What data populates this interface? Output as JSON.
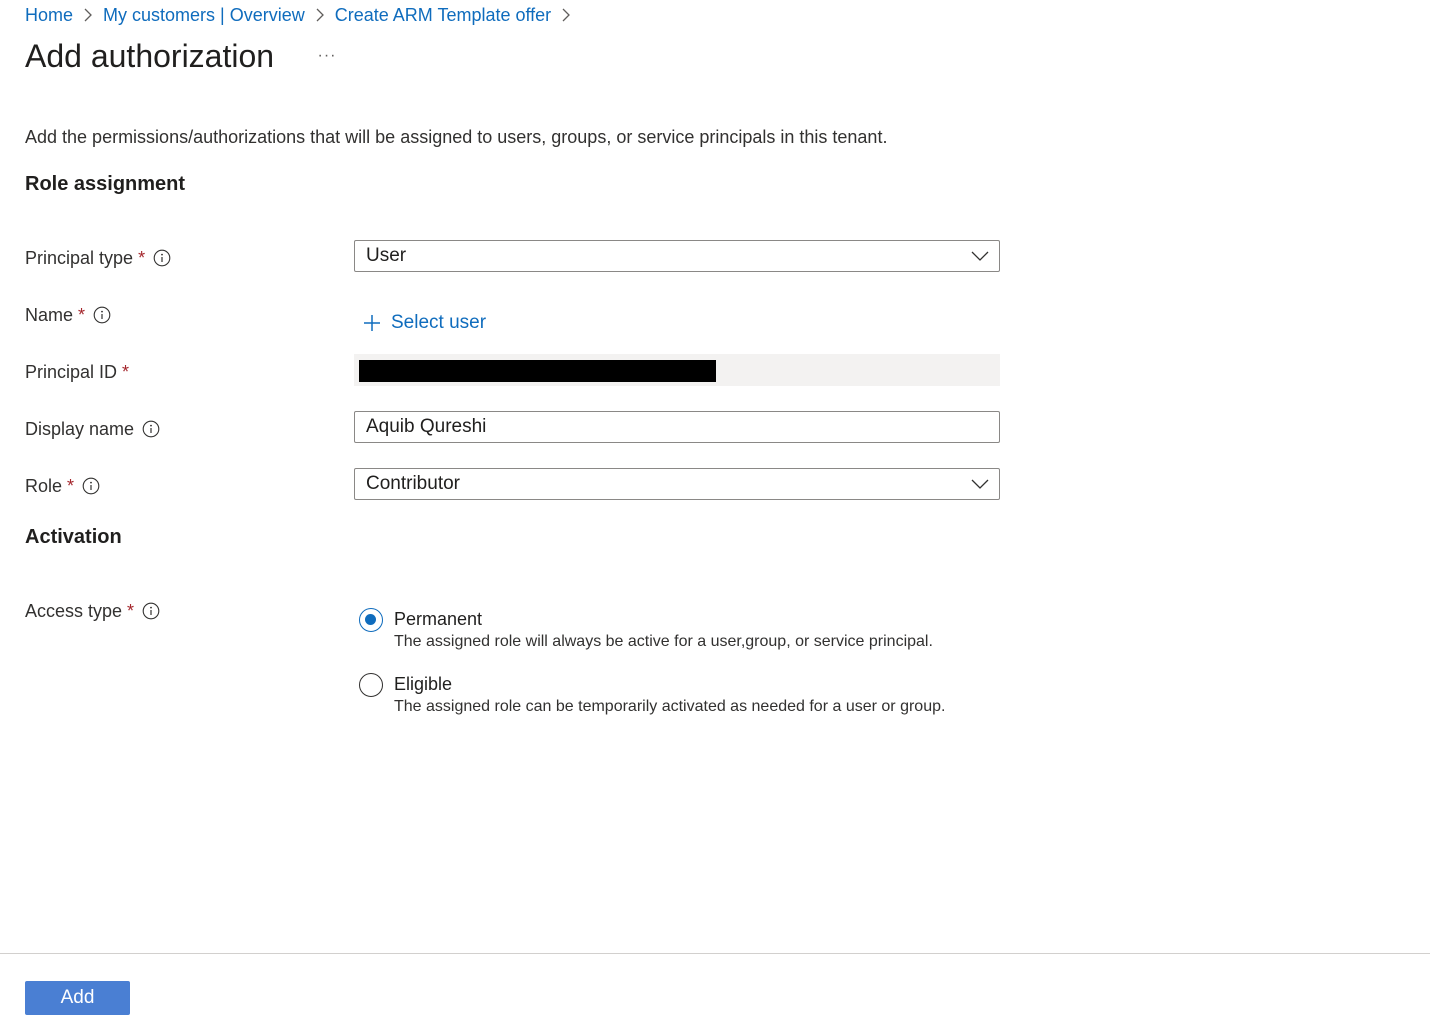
{
  "breadcrumb": [
    {
      "label": "Home"
    },
    {
      "label": "My customers | Overview"
    },
    {
      "label": "Create ARM Template offer"
    }
  ],
  "page": {
    "title": "Add authorization",
    "more_label": "···",
    "description": "Add the permissions/authorizations that will be assigned to users, groups, or service principals in this tenant."
  },
  "role_assignment": {
    "heading": "Role assignment",
    "principal_type": {
      "label": "Principal type",
      "required": "*",
      "value": "User"
    },
    "name": {
      "label": "Name",
      "required": "*",
      "action_label": "Select user"
    },
    "principal_id": {
      "label": "Principal ID",
      "required": "*"
    },
    "display_name": {
      "label": "Display name",
      "value": "Aquib Qureshi"
    },
    "role": {
      "label": "Role",
      "required": "*",
      "value": "Contributor"
    }
  },
  "activation": {
    "heading": "Activation",
    "access_type": {
      "label": "Access type",
      "required": "*",
      "options": [
        {
          "label": "Permanent",
          "description": "The assigned role will always be active for a user,group, or service principal.",
          "selected": true
        },
        {
          "label": "Eligible",
          "description": "The assigned role can be temporarily activated as needed for a user or group.",
          "selected": false
        }
      ]
    }
  },
  "footer": {
    "add_label": "Add"
  },
  "colors": {
    "link": "#0f6cbd",
    "primary_button": "#4a7fd3",
    "required": "#a4262c"
  }
}
